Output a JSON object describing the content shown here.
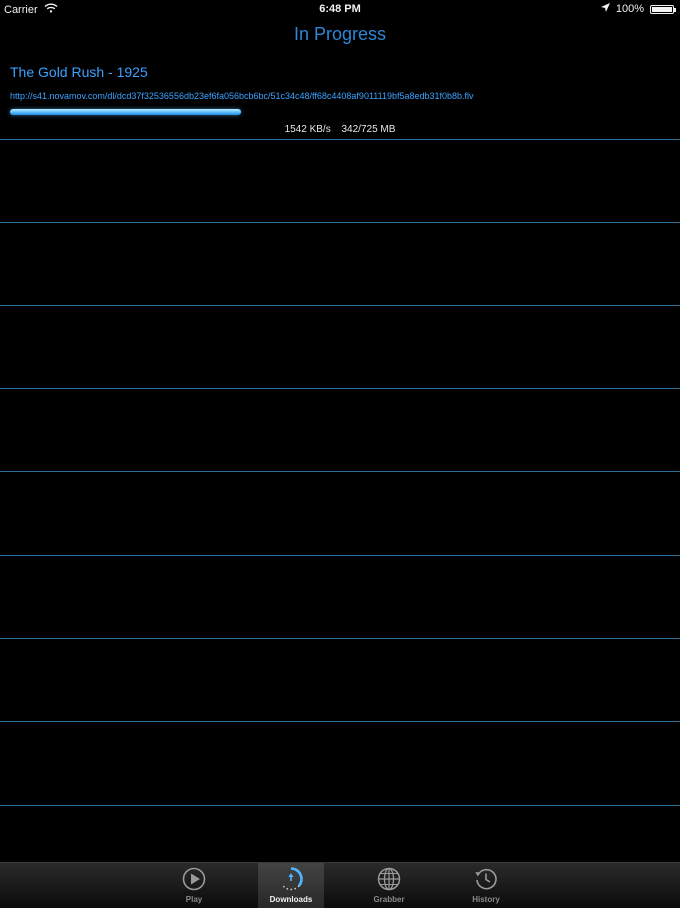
{
  "status_bar": {
    "carrier": "Carrier",
    "time": "6:48 PM",
    "battery": "100%"
  },
  "page": {
    "title": "In Progress"
  },
  "download": {
    "title": "The Gold Rush - 1925",
    "url": "http://s41.novamov.com/dl/dcd37f32536556db23ef6fa056bcb6bc/51c34c48/ff68c4408af9011119bf5a8edb31f0b8b.flv",
    "progress_fraction": 0.405,
    "speed": "1542 KB/s",
    "size": "342/725 MB"
  },
  "tabs": [
    {
      "label": "Play",
      "icon": "play-icon",
      "active": false
    },
    {
      "label": "Downloads",
      "icon": "downloads-icon",
      "active": true
    },
    {
      "label": "Grabber",
      "icon": "globe-icon",
      "active": false
    },
    {
      "label": "History",
      "icon": "history-icon",
      "active": false
    }
  ],
  "colors": {
    "accent": "#3aa3ff",
    "separator": "#2a6f99",
    "background": "#000000"
  }
}
